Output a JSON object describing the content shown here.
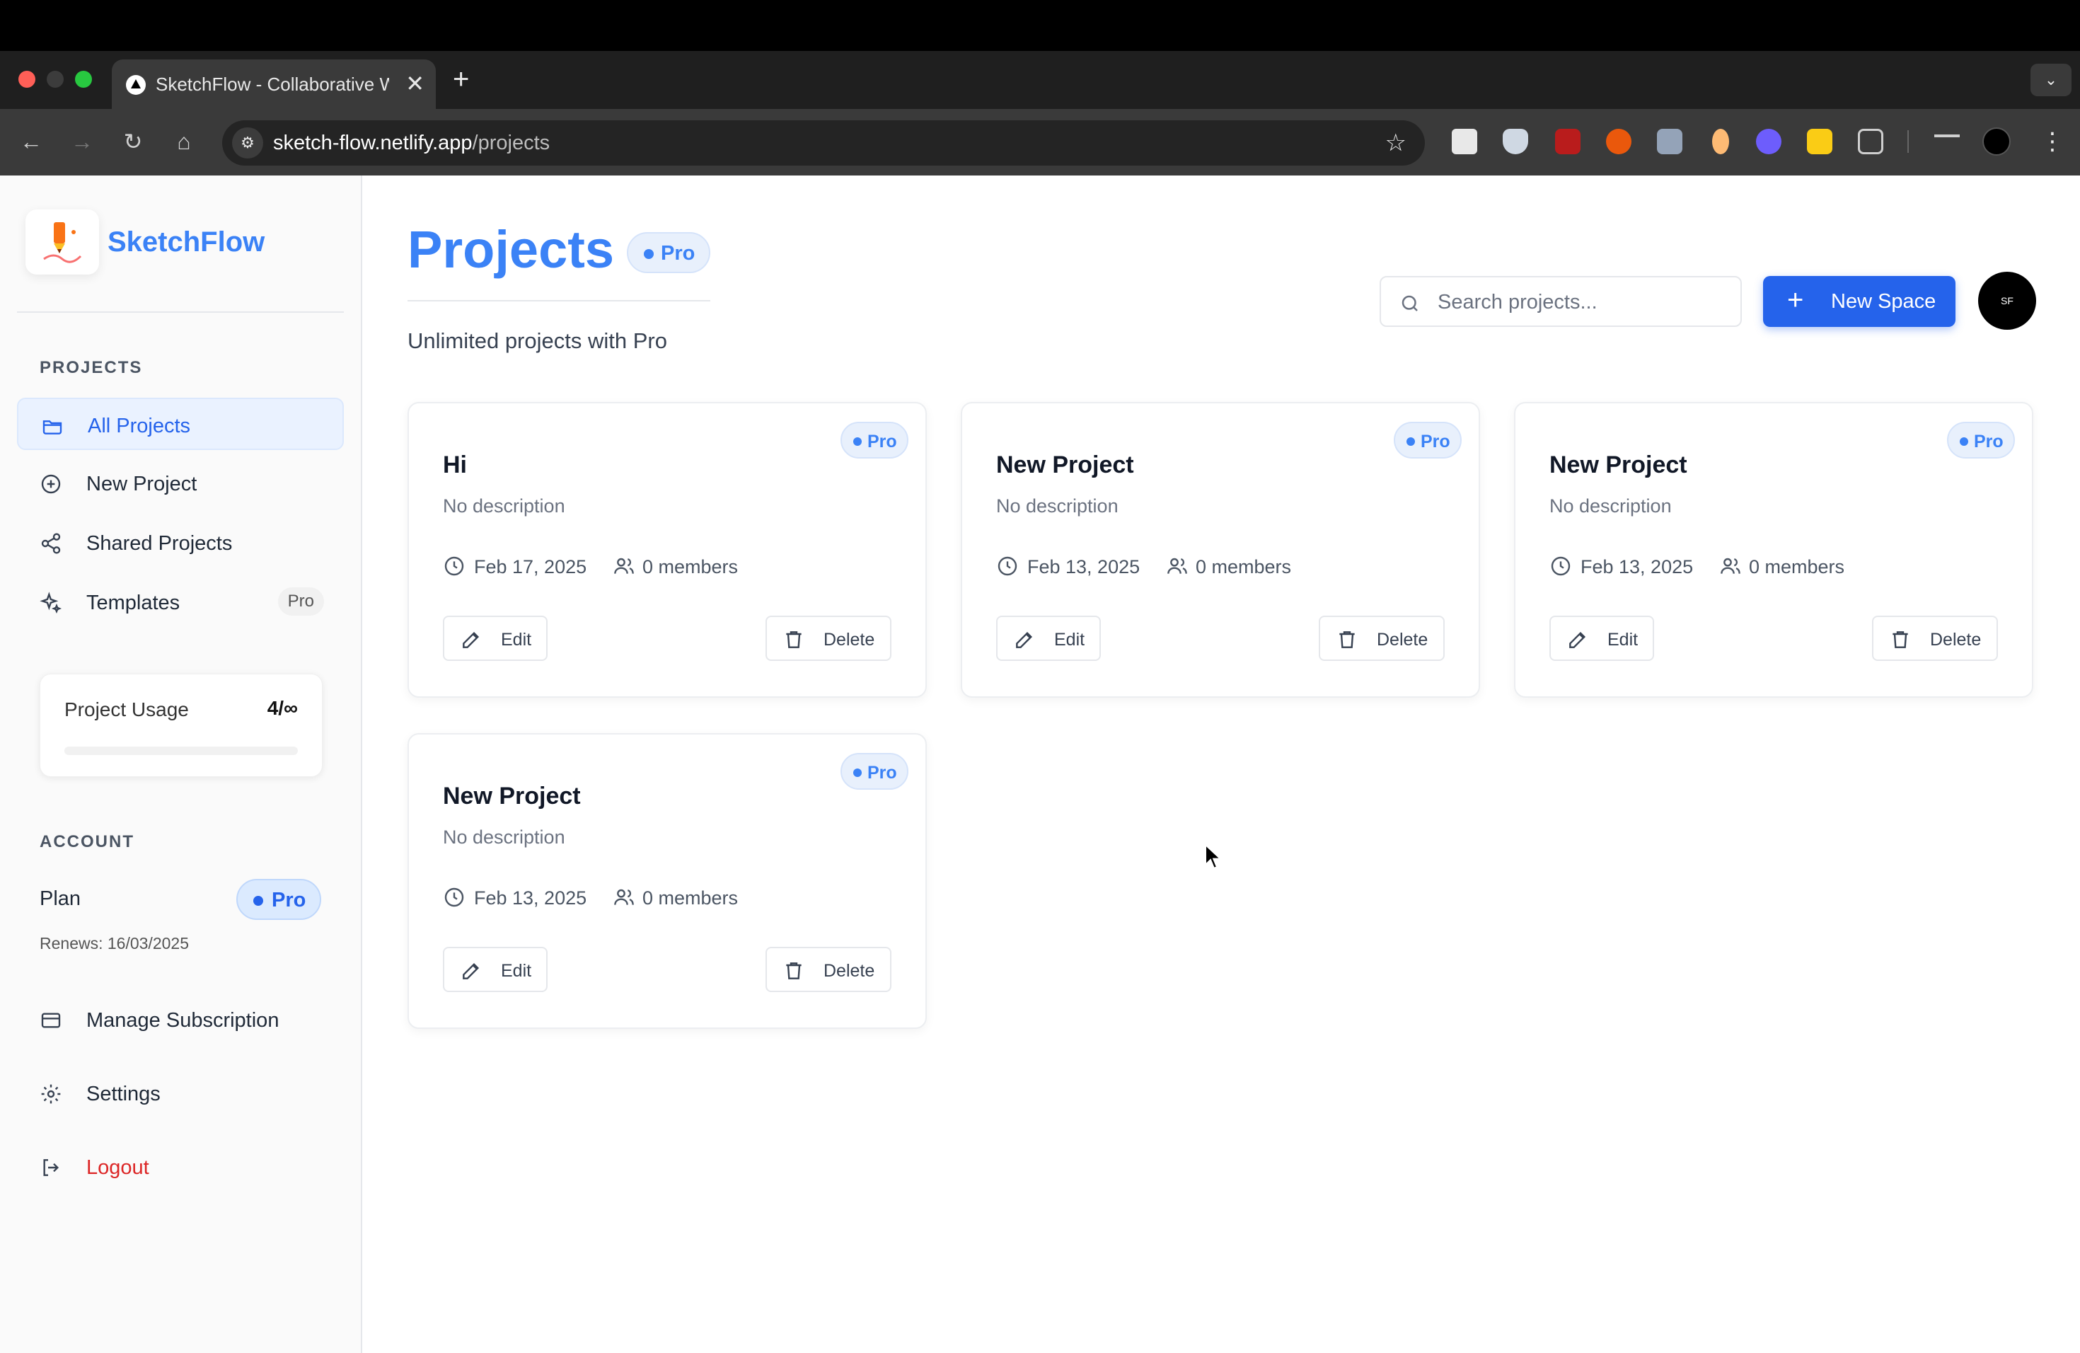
{
  "browser": {
    "tab_title": "SketchFlow - Collaborative W",
    "tab_close": "✕",
    "new_tab": "+",
    "url_host": "sketch-flow.netlify.app",
    "url_path": "/projects"
  },
  "sidebar": {
    "brand": "SketchFlow",
    "projects_section": "PROJECTS",
    "items": [
      {
        "label": "All Projects",
        "icon": "folder-icon",
        "active": true
      },
      {
        "label": "New Project",
        "icon": "plus-circle-icon"
      },
      {
        "label": "Shared Projects",
        "icon": "share-icon"
      },
      {
        "label": "Templates",
        "icon": "sparkles-icon",
        "tag": "Pro"
      }
    ],
    "usage": {
      "label": "Project Usage",
      "value": "4/∞"
    },
    "account_section": "ACCOUNT",
    "plan_label": "Plan",
    "plan_value": "Pro",
    "renews": "Renews: 16/03/2025",
    "account_items": [
      {
        "label": "Manage Subscription",
        "icon": "credit-card-icon"
      },
      {
        "label": "Settings",
        "icon": "gear-icon"
      },
      {
        "label": "Logout",
        "icon": "logout-icon"
      }
    ]
  },
  "header": {
    "title": "Projects",
    "title_badge": "Pro",
    "subtitle": "Unlimited projects with Pro",
    "search_placeholder": "Search projects...",
    "new_space_label": "New Space",
    "avatar_text": "SF"
  },
  "projects": [
    {
      "title": "Hi",
      "description": "No description",
      "date": "Feb 17, 2025",
      "members": "0 members",
      "badge": "Pro",
      "edit": "Edit",
      "delete": "Delete"
    },
    {
      "title": "New Project",
      "description": "No description",
      "date": "Feb 13, 2025",
      "members": "0 members",
      "badge": "Pro",
      "edit": "Edit",
      "delete": "Delete"
    },
    {
      "title": "New Project",
      "description": "No description",
      "date": "Feb 13, 2025",
      "members": "0 members",
      "badge": "Pro",
      "edit": "Edit",
      "delete": "Delete"
    },
    {
      "title": "New Project",
      "description": "No description",
      "date": "Feb 13, 2025",
      "members": "0 members",
      "badge": "Pro",
      "edit": "Edit",
      "delete": "Delete"
    }
  ],
  "colors": {
    "accent": "#3b82f6",
    "primary_button": "#2563eb",
    "danger": "#dc2626",
    "browser_chrome": "#3a3a3a"
  }
}
